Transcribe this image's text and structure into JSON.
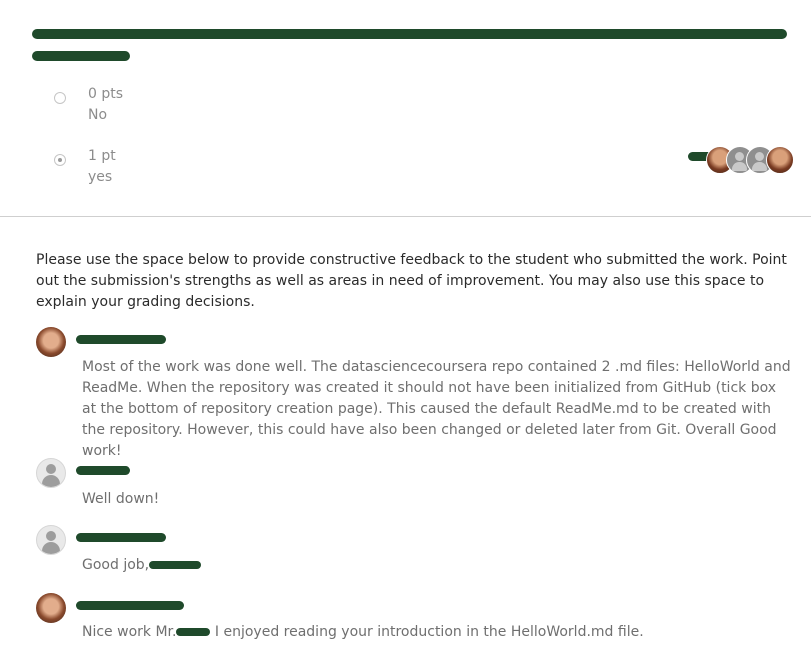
{
  "rubric": {
    "options": [
      {
        "points": "0 pts",
        "label": "No",
        "selected": false
      },
      {
        "points": "1 pt",
        "label": "yes",
        "selected": true
      }
    ]
  },
  "feedback": {
    "instructions": "Please use the space below to provide constructive feedback to the student who submitted the work. Point out the submission's strengths as well as areas in need of improvement. You may also use this space to explain your grading decisions."
  },
  "comments": [
    {
      "avatar": "photo",
      "text": "Most of the work was done well. The datasciencecoursera repo  contained 2 .md files: HelloWorld and ReadMe. When the repository was created it should not have been initialized from GitHub (tick box at the bottom of repository creation page). This caused the default ReadMe.md to be created with the repository. However, this could have also been changed or deleted later from Git. Overall Good work!"
    },
    {
      "avatar": "generic",
      "text": "Well down!"
    },
    {
      "avatar": "generic",
      "text_before": "Good job,"
    },
    {
      "avatar": "photo",
      "text_before": "Nice work Mr.",
      "text_after": " I enjoyed reading your introduction in the HelloWorld.md file."
    }
  ],
  "colors": {
    "redaction": "#1f4a2b",
    "divider": "#cfcfcf",
    "muted_text": "#6f6f6f"
  }
}
